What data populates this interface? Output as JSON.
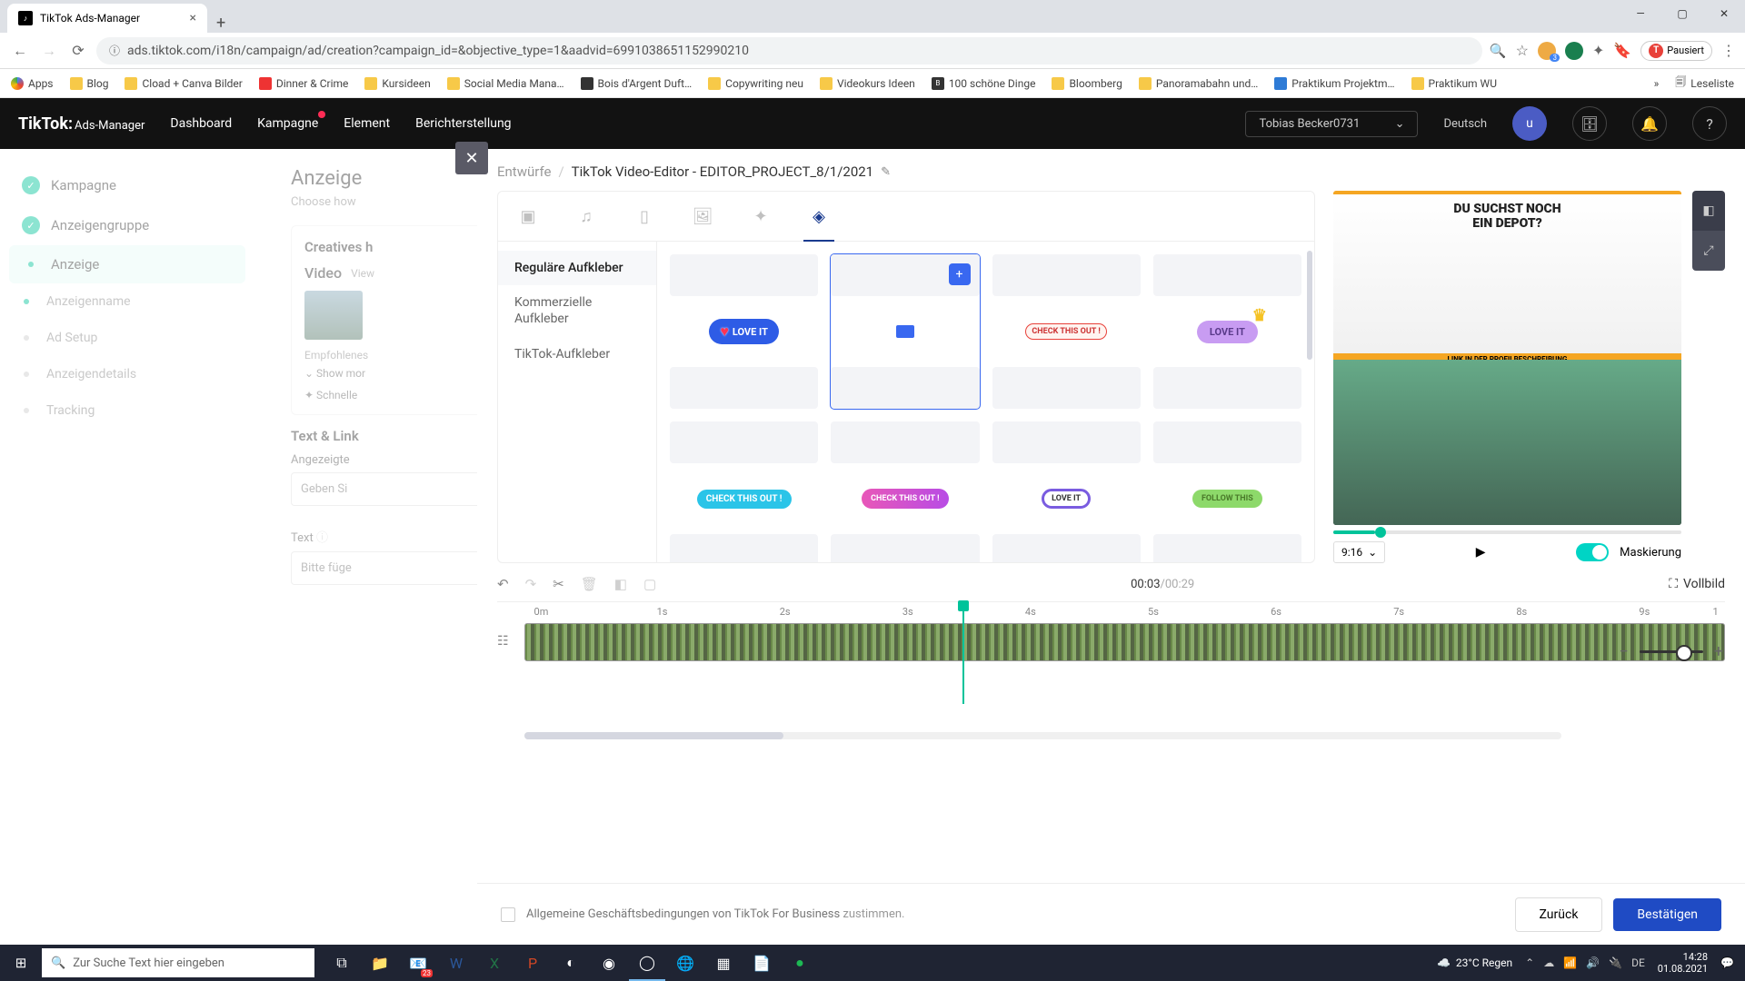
{
  "browser": {
    "tab_title": "TikTok Ads-Manager",
    "url": "ads.tiktok.com/i18n/campaign/ad/creation?campaign_id=&objective_type=1&aadvid=6991038651152990210",
    "pause_label": "Pausiert",
    "bookmarks": [
      "Apps",
      "Blog",
      "Cload + Canva Bilder",
      "Dinner & Crime",
      "Kursideen",
      "Social Media Mana…",
      "Bois d'Argent Duft…",
      "Copywriting neu",
      "Videokurs Ideen",
      "100 schöne Dinge",
      "Bloomberg",
      "Panoramabahn und…",
      "Praktikum Projektm…",
      "Praktikum WU"
    ],
    "reading_list": "Leseliste"
  },
  "header": {
    "logo_main": "TikTok:",
    "logo_sub": "Ads-Manager",
    "nav": [
      "Dashboard",
      "Kampagne",
      "Element",
      "Berichterstellung"
    ],
    "account": "Tobias Becker0731",
    "language": "Deutsch",
    "avatar_letter": "u"
  },
  "sidebar": {
    "items": [
      {
        "label": "Kampagne",
        "state": "done"
      },
      {
        "label": "Anzeigengruppe",
        "state": "done"
      },
      {
        "label": "Anzeige",
        "state": "active"
      }
    ],
    "subs": [
      "Anzeigenname",
      "Ad Setup",
      "Anzeigendetails",
      "Tracking"
    ]
  },
  "bg": {
    "heading": "Anzeige",
    "subhead": "Choose how",
    "creatives_h": "Creatives h",
    "video_lbl": "Video",
    "view_lbl": "View",
    "empf": "Empfohlenes",
    "showmore": "Show mor",
    "schnelle": "Schnelle",
    "textlink": "Text & Link",
    "angez": "Angezeigte",
    "angez_ph": "Geben Si",
    "text_lbl": "Text",
    "text_ph": "Bitte füge",
    "back_btn": "Zurück"
  },
  "modal": {
    "bc1": "Entwürfe",
    "bc2": "TikTok Video-Editor - EDITOR_PROJECT_8/1/2021",
    "categories": [
      "Reguläre Aufkleber",
      "Kommerzielle Aufkleber",
      "TikTok-Aufkleber"
    ],
    "stickers": {
      "loveit": "LOVE IT",
      "checkout": "CHECK THIS OUT !",
      "followthis": "FOLLOW THIS"
    },
    "preview": {
      "line1": "DU SUCHST NOCH",
      "line2": "EIN DEPOT?",
      "link_text": "LINK IN DER PROFILBESCHREIBUNG",
      "ratio": "9:16",
      "mask_label": "Maskierung"
    },
    "timeline": {
      "current": "00:03",
      "total": "/00:29",
      "fullscreen": "Vollbild",
      "ticks": [
        "0m",
        "1s",
        "2s",
        "3s",
        "4s",
        "5s",
        "6s",
        "7s",
        "8s",
        "9s",
        "1"
      ]
    },
    "footer": {
      "terms_a": "Allgemeine Geschäftsbedingungen von TikTok For Business",
      "terms_b": " zustimmen.",
      "back": "Zurück",
      "confirm": "Bestätigen"
    }
  },
  "taskbar": {
    "search_ph": "Zur Suche Text hier eingeben",
    "weather": "23°C Regen",
    "lang": "DE",
    "time": "14:28",
    "date": "01.08.2021"
  }
}
